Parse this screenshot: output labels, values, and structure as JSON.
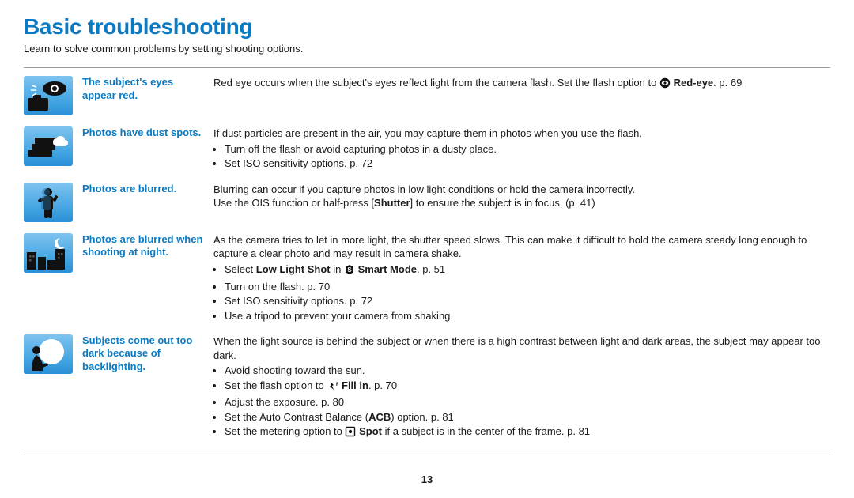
{
  "heading": "Basic troubleshooting",
  "subtitle": "Learn to solve common problems by setting shooting options.",
  "page_number": "13",
  "rows": {
    "redeye": {
      "title": "The subject's eyes appear red.",
      "intro_a": "Red eye occurs when the subject's eyes reflect light from the camera flash. Set the flash option to ",
      "bold1": "Red-eye",
      "intro_b": ". p. 69"
    },
    "dust": {
      "title": "Photos have dust spots.",
      "intro": "If dust particles are present in the air, you may capture them in photos when you use the flash.",
      "b1": "Turn off the flash or avoid capturing photos in a dusty place.",
      "b2": "Set ISO sensitivity options. p. 72"
    },
    "blur": {
      "title": "Photos are blurred.",
      "l1": "Blurring can occur if you capture photos in low light conditions or hold the camera incorrectly.",
      "l2a": "Use the OIS function or half-press [",
      "l2b": "Shutter",
      "l2c": "] to ensure the subject is in focus. (p. 41)"
    },
    "night": {
      "title": "Photos are blurred when shooting at night.",
      "intro": "As the camera tries to let in more light, the shutter speed slows. This can make it difficult to hold the camera steady long enough to capture a clear photo and may result in camera shake.",
      "b1a": "Select ",
      "b1b": "Low Light Shot",
      "b1c": " in ",
      "b1d": "Smart Mode",
      "b1e": ". p. 51",
      "b2": "Turn on the flash. p. 70",
      "b3": "Set ISO sensitivity options. p. 72",
      "b4": "Use a tripod to prevent your camera from shaking."
    },
    "backlight": {
      "title": "Subjects come out too dark because of backlighting.",
      "intro": "When the light source is behind the subject or when there is a high contrast between light and dark areas, the subject may appear too dark.",
      "b1": "Avoid shooting toward the sun.",
      "b2a": "Set the flash option to ",
      "b2b": "Fill in",
      "b2c": ". p. 70",
      "b3": "Adjust the exposure. p. 80",
      "b4a": "Set the Auto Contrast Balance (",
      "b4b": "ACB",
      "b4c": ") option. p. 81",
      "b5a": "Set the metering option to ",
      "b5b": "Spot",
      "b5c": " if a subject is in the center of the frame. p. 81"
    }
  }
}
